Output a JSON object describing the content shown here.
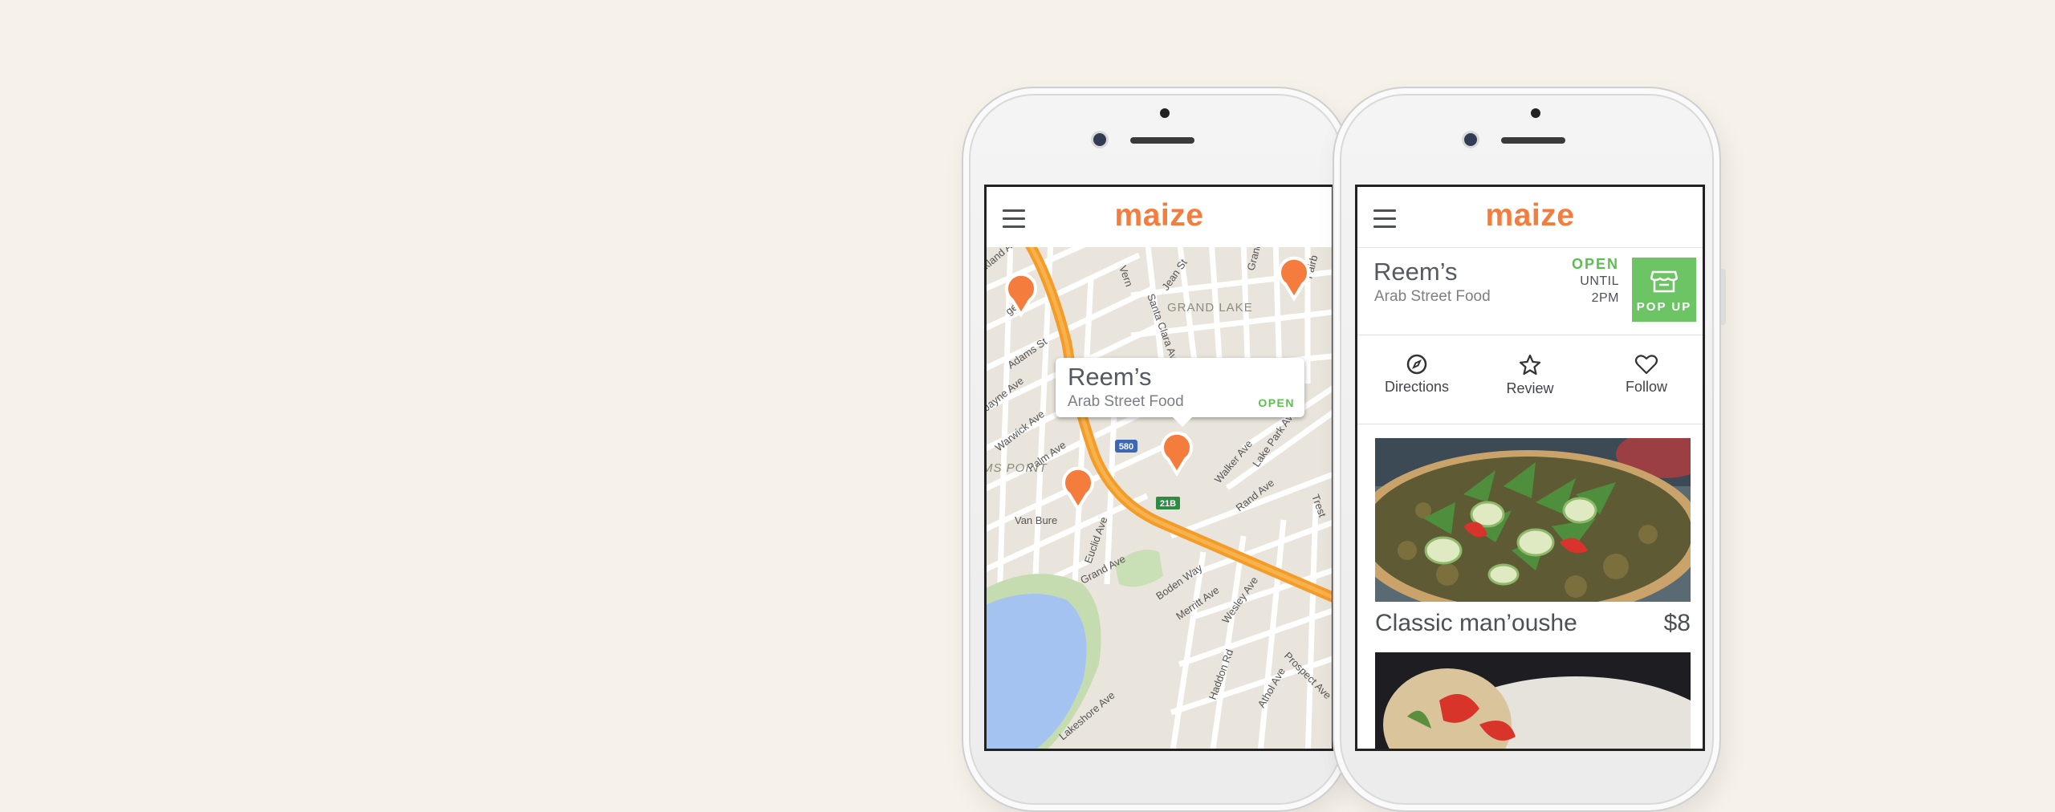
{
  "app": {
    "logo": "maize"
  },
  "map_screen": {
    "street_labels": [
      "kland Ave",
      "Adams St",
      "Jayne Ave",
      "Warwick Ave",
      "Palm Ave",
      "Van Bure",
      "Euclid Ave",
      "Grand Ave",
      "Boden Way",
      "Merritt Ave",
      "Wesley Ave",
      "Haddon Rd",
      "Athol Ave",
      "Prospect Ave",
      "Walker Ave",
      "Rand Ave",
      "Lake Park Ave",
      "Santa Clara Ave",
      "Jean St",
      "Grand Boulevard",
      "Fairb",
      "GRAND LAKE",
      "MS POINT",
      "Lakeshore Ave",
      "Vern",
      "Ma",
      "ge St",
      "Trest"
    ],
    "highway_shields": [
      "580",
      "21B"
    ],
    "callout": {
      "name": "Reem’s",
      "category": "Arab Street Food",
      "status": "OPEN"
    }
  },
  "detail_screen": {
    "vendor_name": "Reem’s",
    "category": "Arab Street Food",
    "status": "OPEN",
    "until": "UNTIL",
    "time": "2PM",
    "badge": "POP UP",
    "actions": [
      {
        "label": "Directions",
        "icon": "compass-icon"
      },
      {
        "label": "Review",
        "icon": "star-icon"
      },
      {
        "label": "Follow",
        "icon": "heart-icon"
      }
    ],
    "menu": [
      {
        "name": "Classic man’oushe",
        "price": "$8"
      }
    ]
  },
  "colors": {
    "brand": "#f47c3c",
    "open": "#5bbf4e",
    "popup": "#6cc465",
    "background": "#f6f2ea"
  }
}
